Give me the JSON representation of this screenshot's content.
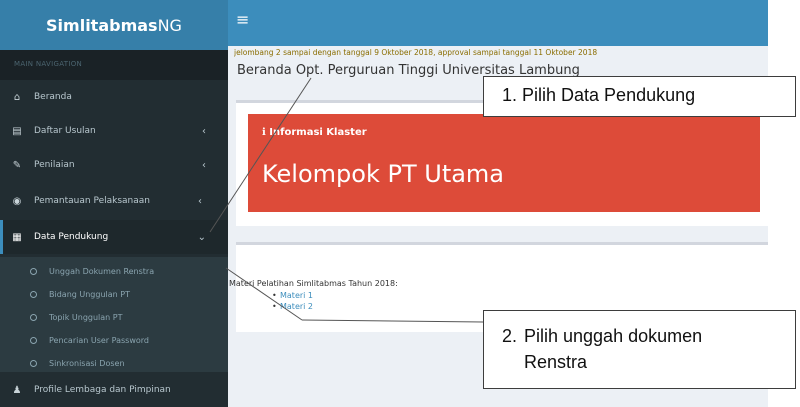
{
  "app": {
    "brand_bold": "Simlitabmas",
    "brand_rest": "NG",
    "menu_toggle_icon": "hamburger-icon"
  },
  "sidebar": {
    "header": "MAIN NAVIGATION",
    "items": [
      {
        "label": "Beranda",
        "icon": "home-icon"
      },
      {
        "label": "Daftar Usulan",
        "icon": "list-icon"
      },
      {
        "label": "Penilaian",
        "icon": "edit-icon"
      },
      {
        "label": "Pemantauan Pelaksanaan",
        "icon": "eye-icon"
      },
      {
        "label": "Data Pendukung",
        "icon": "table-icon",
        "active": true
      },
      {
        "label": "Profile Lembaga dan Pimpinan",
        "icon": "user-icon"
      }
    ],
    "submenu": [
      {
        "label": "Unggah Dokumen Renstra"
      },
      {
        "label": "Bidang Unggulan PT"
      },
      {
        "label": "Topik Unggulan PT"
      },
      {
        "label": "Pencarian User Password"
      },
      {
        "label": "Sinkronisasi Dosen"
      }
    ]
  },
  "content": {
    "marquee": "jelombang 2 sampai dengan tanggal 9 Oktober 2018, approval sampai tanggal 11 Oktober 2018",
    "page_title": "Beranda Opt. Perguruan Tinggi Universitas Lambung",
    "callout": {
      "label": "Informasi Klaster",
      "title": "Kelompok PT Utama",
      "icon": "info-icon",
      "color": "#dd4b39"
    },
    "materi": {
      "heading": "Materi Pelatihan Simlitabmas Tahun 2018:",
      "links": [
        "Materi 1",
        "Materi 2"
      ]
    }
  },
  "annotations": {
    "step1": "1. Pilih Data Pendukung",
    "step2_num": "2.",
    "step2_line1": "Pilih unggah dokumen",
    "step2_line2": "Renstra"
  },
  "colors": {
    "topbar": "#3c8dbc",
    "brand_bg": "#367fa9",
    "sidebar": "#222d32",
    "accent": "#3c8dbc"
  }
}
